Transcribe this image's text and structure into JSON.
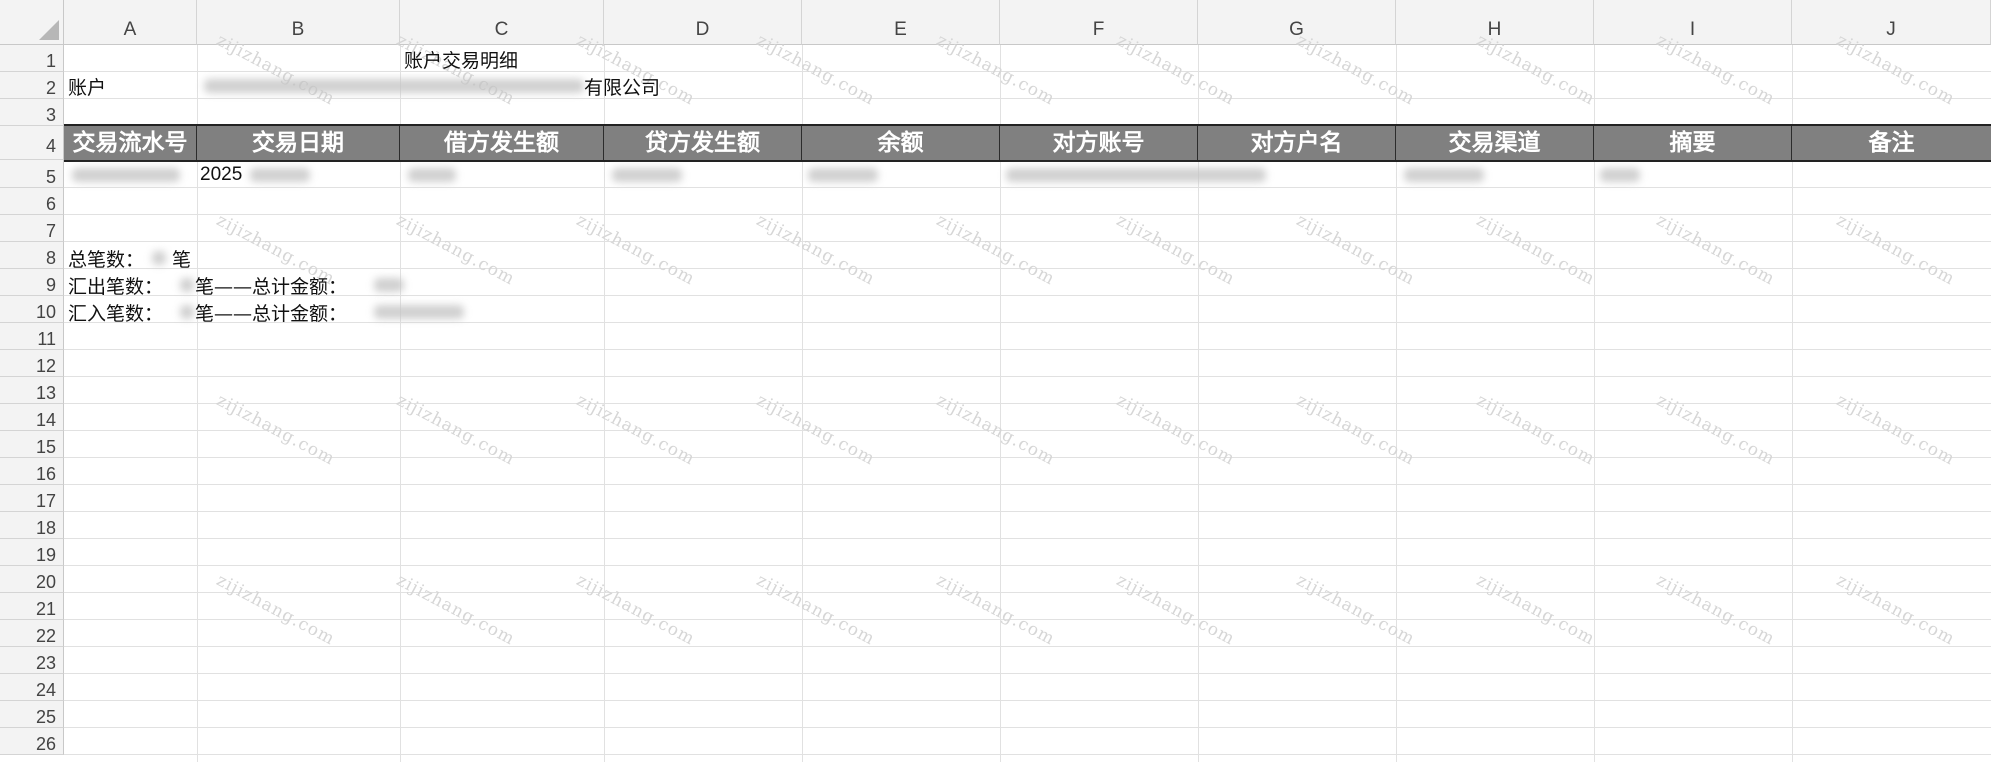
{
  "sheet": {
    "columns": [
      "A",
      "B",
      "C",
      "D",
      "E",
      "F",
      "G",
      "H",
      "I",
      "J"
    ],
    "rows": [
      "1",
      "2",
      "3",
      "4",
      "5",
      "6",
      "7",
      "8",
      "9",
      "10",
      "11",
      "12",
      "13",
      "14",
      "15",
      "16",
      "17",
      "18",
      "19",
      "20",
      "21",
      "22",
      "23",
      "24",
      "25",
      "26"
    ]
  },
  "cells": {
    "title": "账户交易明细",
    "account_label": "账户",
    "company_suffix": "有限公司",
    "date_prefix": "2025",
    "total_label": "总笔数：",
    "total_unit": "笔",
    "out_label": "汇出笔数：",
    "out_amount_label": "笔——总计金额：",
    "in_label": "汇入笔数：",
    "in_amount_label": "笔——总计金额："
  },
  "table_headers": [
    "交易流水号",
    "交易日期",
    "借方发生额",
    "贷方发生额",
    "余额",
    "对方账号",
    "对方户名",
    "交易渠道",
    "摘要",
    "备注"
  ],
  "watermark": "zijizhang.com"
}
